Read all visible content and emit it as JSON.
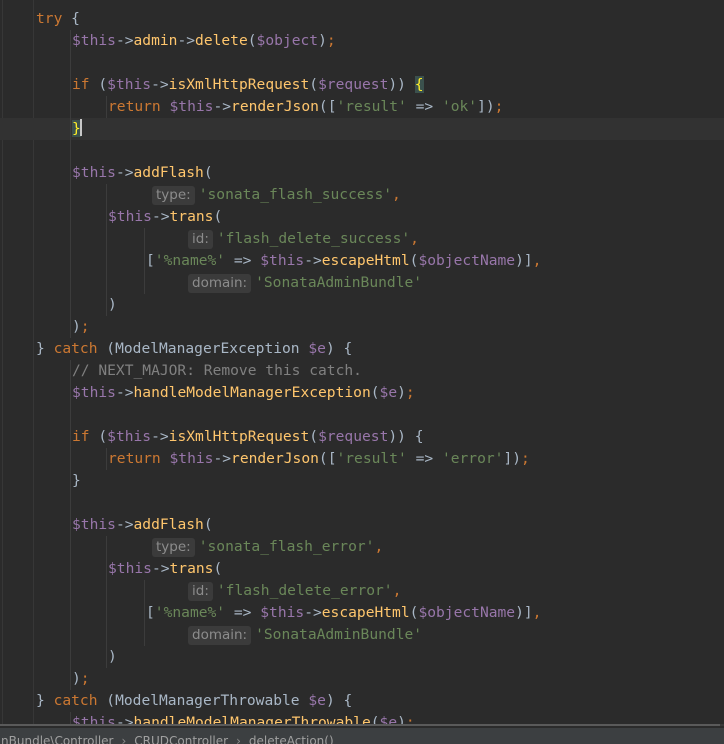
{
  "editor": {
    "lines": [
      [
        [
          "kw",
          "try"
        ],
        [
          "pl",
          " {"
        ]
      ],
      [
        [
          "var",
          "$this"
        ],
        [
          "pl",
          "->"
        ],
        [
          "fn",
          "admin"
        ],
        [
          "pl",
          "->"
        ],
        [
          "fn",
          "delete"
        ],
        [
          "pl",
          "("
        ],
        [
          "var",
          "$object"
        ],
        [
          "pl",
          ")"
        ],
        [
          "kw",
          ";"
        ]
      ],
      [],
      [
        [
          "kw",
          "if"
        ],
        [
          "pl",
          " ("
        ],
        [
          "var",
          "$this"
        ],
        [
          "pl",
          "->"
        ],
        [
          "fn",
          "isXmlHttpRequest"
        ],
        [
          "pl",
          "("
        ],
        [
          "var",
          "$request"
        ],
        [
          "pl",
          ")) "
        ],
        [
          "match",
          "{"
        ]
      ],
      [
        [
          "kw",
          "return "
        ],
        [
          "var",
          "$this"
        ],
        [
          "pl",
          "->"
        ],
        [
          "fn",
          "renderJson"
        ],
        [
          "pl",
          "(["
        ],
        [
          "str",
          "'result'"
        ],
        [
          "pl",
          " => "
        ],
        [
          "str",
          "'ok'"
        ],
        [
          "pl",
          "])"
        ],
        [
          "kw",
          ";"
        ]
      ],
      [
        [
          "match",
          "}"
        ],
        [
          "caret",
          ""
        ]
      ],
      [],
      [
        [
          "var",
          "$this"
        ],
        [
          "pl",
          "->"
        ],
        [
          "fn",
          "addFlash"
        ],
        [
          "pl",
          "("
        ]
      ],
      [
        [
          "hint",
          "type:"
        ],
        [
          "str",
          "'sonata_flash_success'"
        ],
        [
          "kw",
          ","
        ]
      ],
      [
        [
          "var",
          "$this"
        ],
        [
          "pl",
          "->"
        ],
        [
          "fn",
          "trans"
        ],
        [
          "pl",
          "("
        ]
      ],
      [
        [
          "hint",
          "id:"
        ],
        [
          "str",
          "'flash_delete_success'"
        ],
        [
          "kw",
          ","
        ]
      ],
      [
        [
          "pl",
          "["
        ],
        [
          "str",
          "'%name%'"
        ],
        [
          "pl",
          " => "
        ],
        [
          "var",
          "$this"
        ],
        [
          "pl",
          "->"
        ],
        [
          "fn",
          "escapeHtml"
        ],
        [
          "pl",
          "("
        ],
        [
          "var",
          "$objectName"
        ],
        [
          "pl",
          ")]"
        ],
        [
          "kw",
          ","
        ]
      ],
      [
        [
          "hint",
          "domain:"
        ],
        [
          "str",
          "'SonataAdminBundle'"
        ]
      ],
      [
        [
          "pl",
          ")"
        ]
      ],
      [
        [
          "pl",
          ")"
        ],
        [
          "kw",
          ";"
        ]
      ],
      [
        [
          "pl",
          "} "
        ],
        [
          "kw",
          "catch"
        ],
        [
          "pl",
          " (ModelManagerException "
        ],
        [
          "var",
          "$e"
        ],
        [
          "pl",
          ") {"
        ]
      ],
      [
        [
          "cm",
          "// NEXT_MAJOR: Remove this catch."
        ]
      ],
      [
        [
          "var",
          "$this"
        ],
        [
          "pl",
          "->"
        ],
        [
          "fn",
          "handleModelManagerException"
        ],
        [
          "pl",
          "("
        ],
        [
          "var",
          "$e"
        ],
        [
          "pl",
          ")"
        ],
        [
          "kw",
          ";"
        ]
      ],
      [],
      [
        [
          "kw",
          "if"
        ],
        [
          "pl",
          " ("
        ],
        [
          "var",
          "$this"
        ],
        [
          "pl",
          "->"
        ],
        [
          "fn",
          "isXmlHttpRequest"
        ],
        [
          "pl",
          "("
        ],
        [
          "var",
          "$request"
        ],
        [
          "pl",
          ")) {"
        ]
      ],
      [
        [
          "kw",
          "return "
        ],
        [
          "var",
          "$this"
        ],
        [
          "pl",
          "->"
        ],
        [
          "fn",
          "renderJson"
        ],
        [
          "pl",
          "(["
        ],
        [
          "str",
          "'result'"
        ],
        [
          "pl",
          " => "
        ],
        [
          "str",
          "'error'"
        ],
        [
          "pl",
          "])"
        ],
        [
          "kw",
          ";"
        ]
      ],
      [
        [
          "pl",
          "}"
        ]
      ],
      [],
      [
        [
          "var",
          "$this"
        ],
        [
          "pl",
          "->"
        ],
        [
          "fn",
          "addFlash"
        ],
        [
          "pl",
          "("
        ]
      ],
      [
        [
          "hint",
          "type:"
        ],
        [
          "str",
          "'sonata_flash_error'"
        ],
        [
          "kw",
          ","
        ]
      ],
      [
        [
          "var",
          "$this"
        ],
        [
          "pl",
          "->"
        ],
        [
          "fn",
          "trans"
        ],
        [
          "pl",
          "("
        ]
      ],
      [
        [
          "hint",
          "id:"
        ],
        [
          "str",
          "'flash_delete_error'"
        ],
        [
          "kw",
          ","
        ]
      ],
      [
        [
          "pl",
          "["
        ],
        [
          "str",
          "'%name%'"
        ],
        [
          "pl",
          " => "
        ],
        [
          "var",
          "$this"
        ],
        [
          "pl",
          "->"
        ],
        [
          "fn",
          "escapeHtml"
        ],
        [
          "pl",
          "("
        ],
        [
          "var",
          "$objectName"
        ],
        [
          "pl",
          ")]"
        ],
        [
          "kw",
          ","
        ]
      ],
      [
        [
          "hint",
          "domain:"
        ],
        [
          "str",
          "'SonataAdminBundle'"
        ]
      ],
      [
        [
          "pl",
          ")"
        ]
      ],
      [
        [
          "pl",
          ")"
        ],
        [
          "kw",
          ";"
        ]
      ],
      [
        [
          "pl",
          "} "
        ],
        [
          "kw",
          "catch"
        ],
        [
          "pl",
          " (ModelManagerThrowable "
        ],
        [
          "var",
          "$e"
        ],
        [
          "pl",
          ") {"
        ]
      ],
      [
        [
          "var",
          "$this"
        ],
        [
          "pl",
          "->"
        ],
        [
          "fn",
          "handleModelManagerThrowable"
        ],
        [
          "pl",
          "("
        ],
        [
          "var",
          "$e"
        ],
        [
          "pl",
          ")"
        ],
        [
          "kw",
          ";"
        ]
      ]
    ]
  },
  "breadcrumb": {
    "items": [
      "minBundle\\Controller",
      "CRUDController",
      "deleteAction()"
    ],
    "separator": "›"
  },
  "colors": {
    "background": "#2b2b2b",
    "keyword": "#cc7832",
    "variable": "#9876aa",
    "function": "#ffc66d",
    "string": "#6a8759",
    "text": "#a9b7c6",
    "comment": "#808080"
  }
}
